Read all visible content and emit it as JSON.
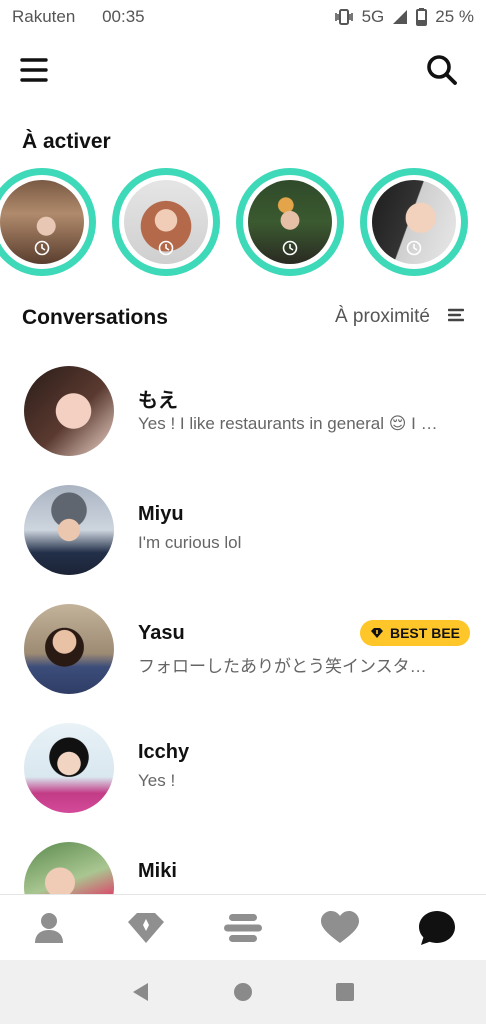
{
  "status_bar": {
    "carrier": "Rakuten",
    "time": "00:35",
    "network": "5G",
    "battery": "25 %"
  },
  "top_bar": {
    "menu_icon": "hamburger-menu-icon",
    "search_icon": "search-icon"
  },
  "activate": {
    "title": "À activer",
    "ring_color": "#3ed9b8",
    "stories": [
      {
        "icon": "clock-icon"
      },
      {
        "icon": "clock-icon"
      },
      {
        "icon": "clock-icon"
      },
      {
        "icon": "clock-icon"
      }
    ]
  },
  "conversations": {
    "title": "Conversations",
    "sort_label": "À proximité",
    "sort_icon": "sort-lines-icon",
    "items": [
      {
        "name": "もえ",
        "message": "Yes ! I like restaurants in general 😌 I …",
        "badge": ""
      },
      {
        "name": "Miyu",
        "message": "I'm curious lol",
        "badge": ""
      },
      {
        "name": "Yasu",
        "message": "フォローしたありがとう笑インスタ…",
        "badge": "BEST BEE"
      },
      {
        "name": "Icchy",
        "message": "Yes !",
        "badge": ""
      },
      {
        "name": "Miki",
        "message": "",
        "badge": ""
      }
    ]
  },
  "tab_bar": {
    "tabs": [
      "profile-icon",
      "diamond-icon",
      "discover-icon",
      "heart-icon",
      "chat-icon"
    ],
    "active_color": "#111111",
    "inactive_color": "#8f8f8f"
  },
  "nav_bar": {
    "buttons": [
      "back-icon",
      "home-icon",
      "recents-icon"
    ]
  },
  "colors": {
    "badge": "#ffc629"
  }
}
